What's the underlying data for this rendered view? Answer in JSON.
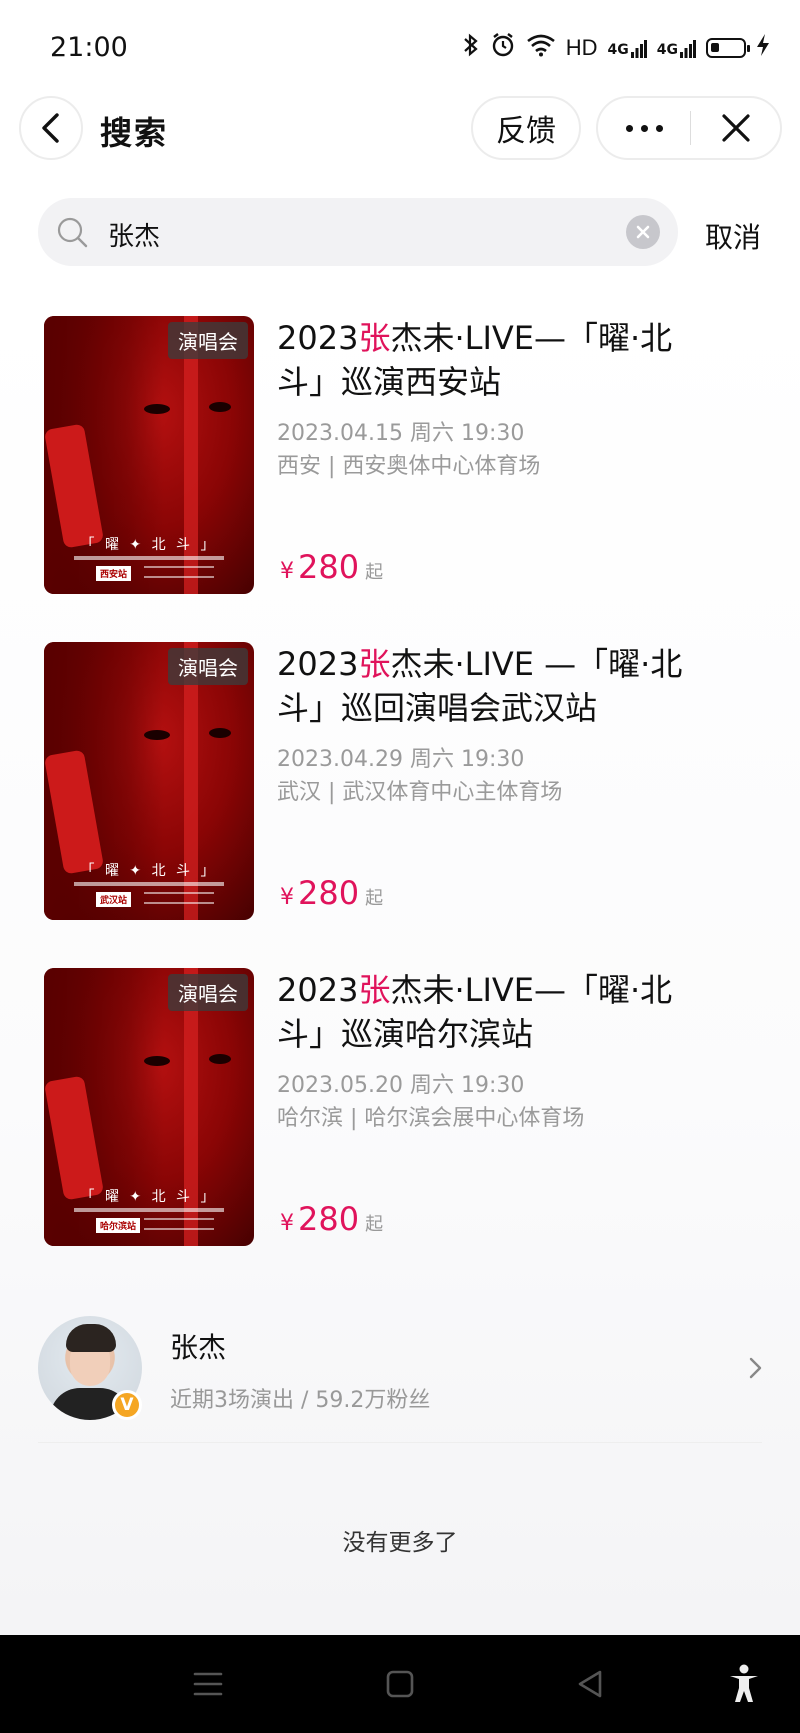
{
  "status_bar": {
    "time": "21:00",
    "hd_label": "HD",
    "signal_1": "4G",
    "signal_2": "4G",
    "icons": [
      "bluetooth-icon",
      "alarm-icon",
      "wifi-icon",
      "signal-icon",
      "battery-icon",
      "charging-icon"
    ]
  },
  "nav": {
    "title": "搜索",
    "feedback_label": "反馈",
    "more_icon": "more-icon",
    "close_icon": "close-icon",
    "back_icon": "back-arrow-icon"
  },
  "search": {
    "value": "张杰",
    "cancel_label": "取消",
    "search_icon": "search-icon",
    "clear_icon": "clear-icon"
  },
  "events": [
    {
      "badge": "演唱会",
      "title_prefix": "2023",
      "title_highlight": "张",
      "title_rest": "杰未·LIVE—「曜·北斗」巡演西安站",
      "date": "2023.04.15 周六 19:30",
      "venue": "西安 | 西安奥体中心体育场",
      "price_symbol": "¥",
      "price": "280",
      "price_unit": "起",
      "poster_title": "「 曜 ✦ 北 斗 」",
      "poster_city": "西安站"
    },
    {
      "badge": "演唱会",
      "title_prefix": "2023",
      "title_highlight": "张",
      "title_rest": "杰未·LIVE —「曜·北斗」巡回演唱会武汉站",
      "date": "2023.04.29 周六 19:30",
      "venue": "武汉 | 武汉体育中心主体育场",
      "price_symbol": "¥",
      "price": "280",
      "price_unit": "起",
      "poster_title": "「 曜 ✦ 北 斗 」",
      "poster_city": "武汉站"
    },
    {
      "badge": "演唱会",
      "title_prefix": "2023",
      "title_highlight": "张",
      "title_rest": "杰未·LIVE—「曜·北斗」巡演哈尔滨站",
      "date": "2023.05.20 周六 19:30",
      "venue": "哈尔滨 | 哈尔滨会展中心体育场",
      "price_symbol": "¥",
      "price": "280",
      "price_unit": "起",
      "poster_title": "「 曜 ✦ 北 斗 」",
      "poster_city": "哈尔滨站"
    }
  ],
  "artist": {
    "name": "张杰",
    "meta": "近期3场演出 / 59.2万粉丝",
    "verified_badge": "V"
  },
  "footer": {
    "no_more": "没有更多了"
  },
  "system_nav": {
    "icons": [
      "menu-icon",
      "home-square-icon",
      "back-triangle-icon",
      "accessibility-icon"
    ]
  },
  "colors": {
    "accent": "#e0135b",
    "poster_red": "#b41010",
    "meta_gray": "#9a9a9a",
    "verified": "#f5a623"
  }
}
